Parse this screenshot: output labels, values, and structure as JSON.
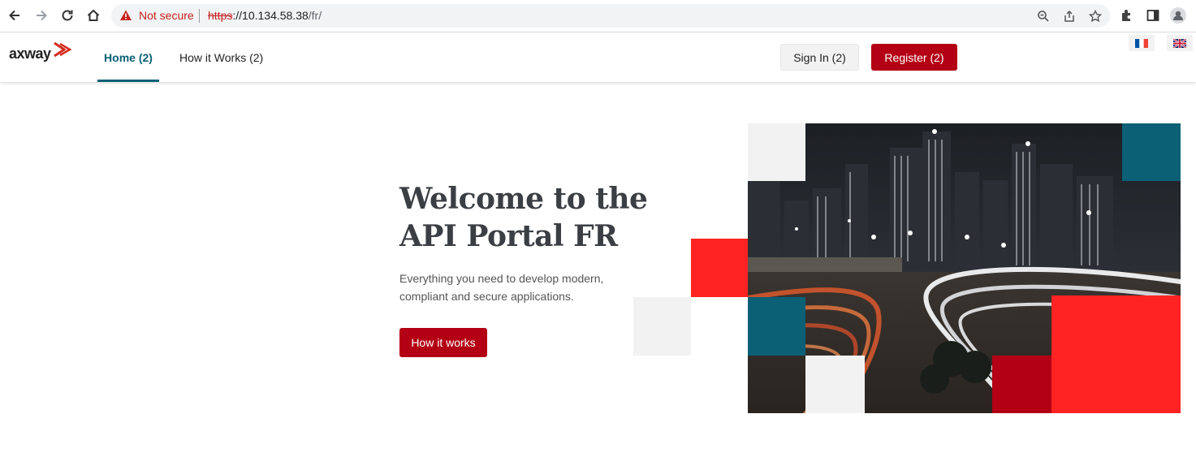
{
  "browser": {
    "security_label": "Not secure",
    "url_scheme": "https",
    "url_host": "://10.134.58.38",
    "url_path": "/fr/"
  },
  "header": {
    "logo_text": "axway",
    "nav": [
      {
        "label": "Home (2)",
        "active": true
      },
      {
        "label": "How it Works (2)",
        "active": false
      }
    ],
    "signin_label": "Sign In (2)",
    "register_label": "Register (2)",
    "languages": [
      "fr",
      "en"
    ]
  },
  "hero": {
    "title_line1": "Welcome to the",
    "title_line2": "API Portal FR",
    "subtitle_line1": "Everything you need to develop modern,",
    "subtitle_line2": "compliant and secure applications.",
    "cta_label": "How it works"
  },
  "colors": {
    "brand_red": "#b30014",
    "accent_red": "#ff2323",
    "teal": "#0b6076",
    "light_gray": "#f2f2f2"
  }
}
